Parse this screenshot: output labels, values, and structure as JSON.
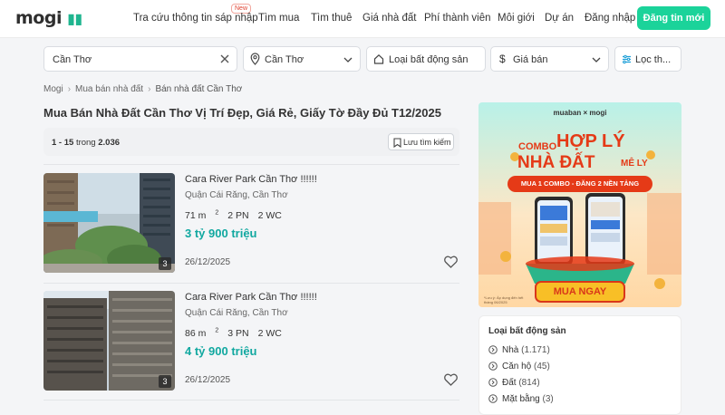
{
  "header": {
    "logo": "mogi",
    "nav": [
      {
        "label": "Tra cứu thông tin sáp nhập",
        "badge": "New"
      },
      {
        "label": "Tìm mua"
      },
      {
        "label": "Tìm thuê"
      },
      {
        "label": "Giá nhà đất"
      },
      {
        "label": "Phí thành viên"
      },
      {
        "label": "Môi giới"
      },
      {
        "label": "Dự án"
      },
      {
        "label": "Đăng nhập"
      }
    ],
    "post_button": "Đăng tin mới"
  },
  "search": {
    "keyword": "Cần Thơ",
    "location": "Cần Thơ",
    "property_type": "Loại bất động sản",
    "price": "Giá bán",
    "more_filters": "Lọc th..."
  },
  "breadcrumb": [
    "Mogi",
    "Mua bán nhà đất",
    "Bán nhà đất Cần Thơ"
  ],
  "page_title": "Mua Bán Nhà Đất Cần Thơ Vị Trí Đẹp, Giá Rẻ, Giấy Tờ Đầy Đủ T12/2025",
  "results": {
    "range": "1 - 15",
    "word": "trong",
    "total": "2.036",
    "save_search": "Lưu tìm kiếm"
  },
  "listings": [
    {
      "title": "Cara River Park Cần Thơ !!!!!!",
      "address": "Quận Cái Răng, Cần Thơ",
      "area": "71 m",
      "area_unit_sup": "2",
      "bedrooms": "2 PN",
      "bathrooms": "2 WC",
      "price": "3 tỷ 900 triệu",
      "date": "26/12/2025",
      "photo_count": "3"
    },
    {
      "title": "Cara River Park Cần Thơ !!!!!!",
      "address": "Quận Cái Răng, Cần Thơ",
      "area": "86 m",
      "area_unit_sup": "2",
      "bedrooms": "3 PN",
      "bathrooms": "2 WC",
      "price": "4 tỷ 900 triệu",
      "date": "26/12/2025",
      "photo_count": "3"
    }
  ],
  "banner": {
    "brand": "muaban × mogi",
    "combo": "COMBO",
    "headline_1": "HỢP LÝ",
    "headline_2": "NHÀ ĐẤT",
    "headline_3": "MÊ LY",
    "subline": "MUA 1 COMBO - ĐĂNG 2 NỀN TẢNG",
    "cta": "MUA NGAY",
    "fineprint": "*Lưu ý: Áp dụng đến hết tháng 06/2025"
  },
  "filter_card": {
    "title": "Loại bất động sản",
    "items": [
      {
        "label": "Nhà",
        "count": "(1.171)"
      },
      {
        "label": "Căn hộ",
        "count": "(45)"
      },
      {
        "label": "Đất",
        "count": "(814)"
      },
      {
        "label": "Mặt bằng",
        "count": "(3)"
      }
    ]
  },
  "colors": {
    "accent": "#1bd39a",
    "price": "#11a8a0",
    "banner_red": "#e53a17"
  }
}
